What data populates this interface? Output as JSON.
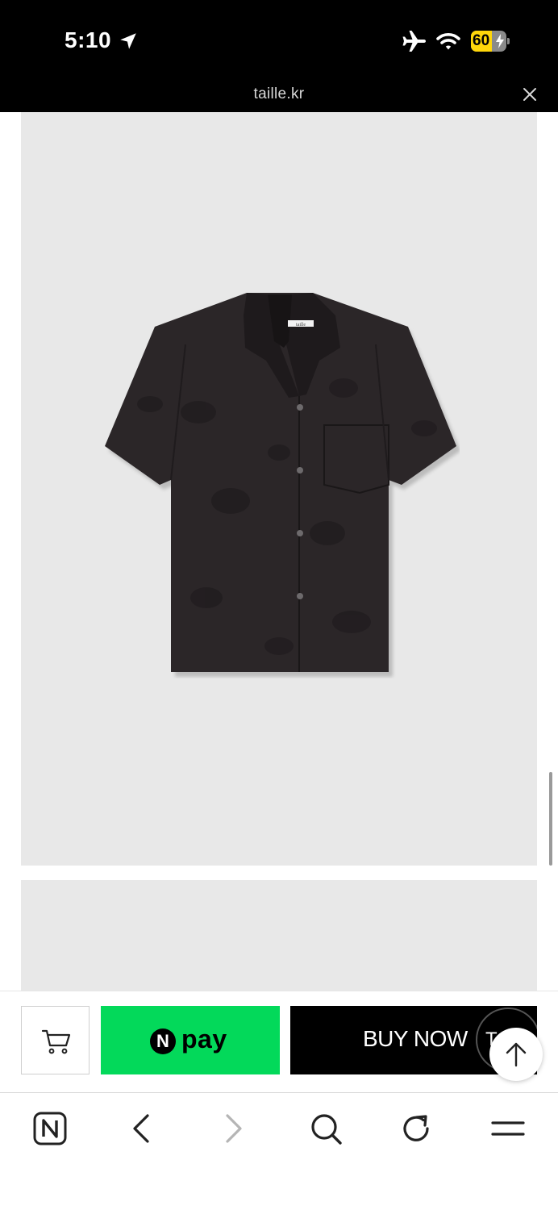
{
  "status_bar": {
    "time": "5:10",
    "battery_level": "60",
    "battery_fraction": 0.6,
    "icons": [
      "location-arrow-icon",
      "airplane-icon",
      "wifi-icon",
      "battery-icon"
    ]
  },
  "browser": {
    "url": "taille.kr"
  },
  "product": {
    "label_text": "taille"
  },
  "purchase_bar": {
    "npay_badge": "N",
    "npay_label": "pay",
    "buy_now_label": "BUY NOW",
    "talk_label": "Talk"
  },
  "toolbar": {
    "buttons": [
      "naver-home-icon",
      "back-arrow-icon",
      "forward-arrow-icon",
      "search-icon",
      "refresh-icon",
      "menu-icon"
    ]
  },
  "colors": {
    "npay_green": "#03d95a",
    "battery_yellow": "#ffd60a",
    "buy_now_black": "#000000",
    "image_background": "#e8e8e8"
  }
}
